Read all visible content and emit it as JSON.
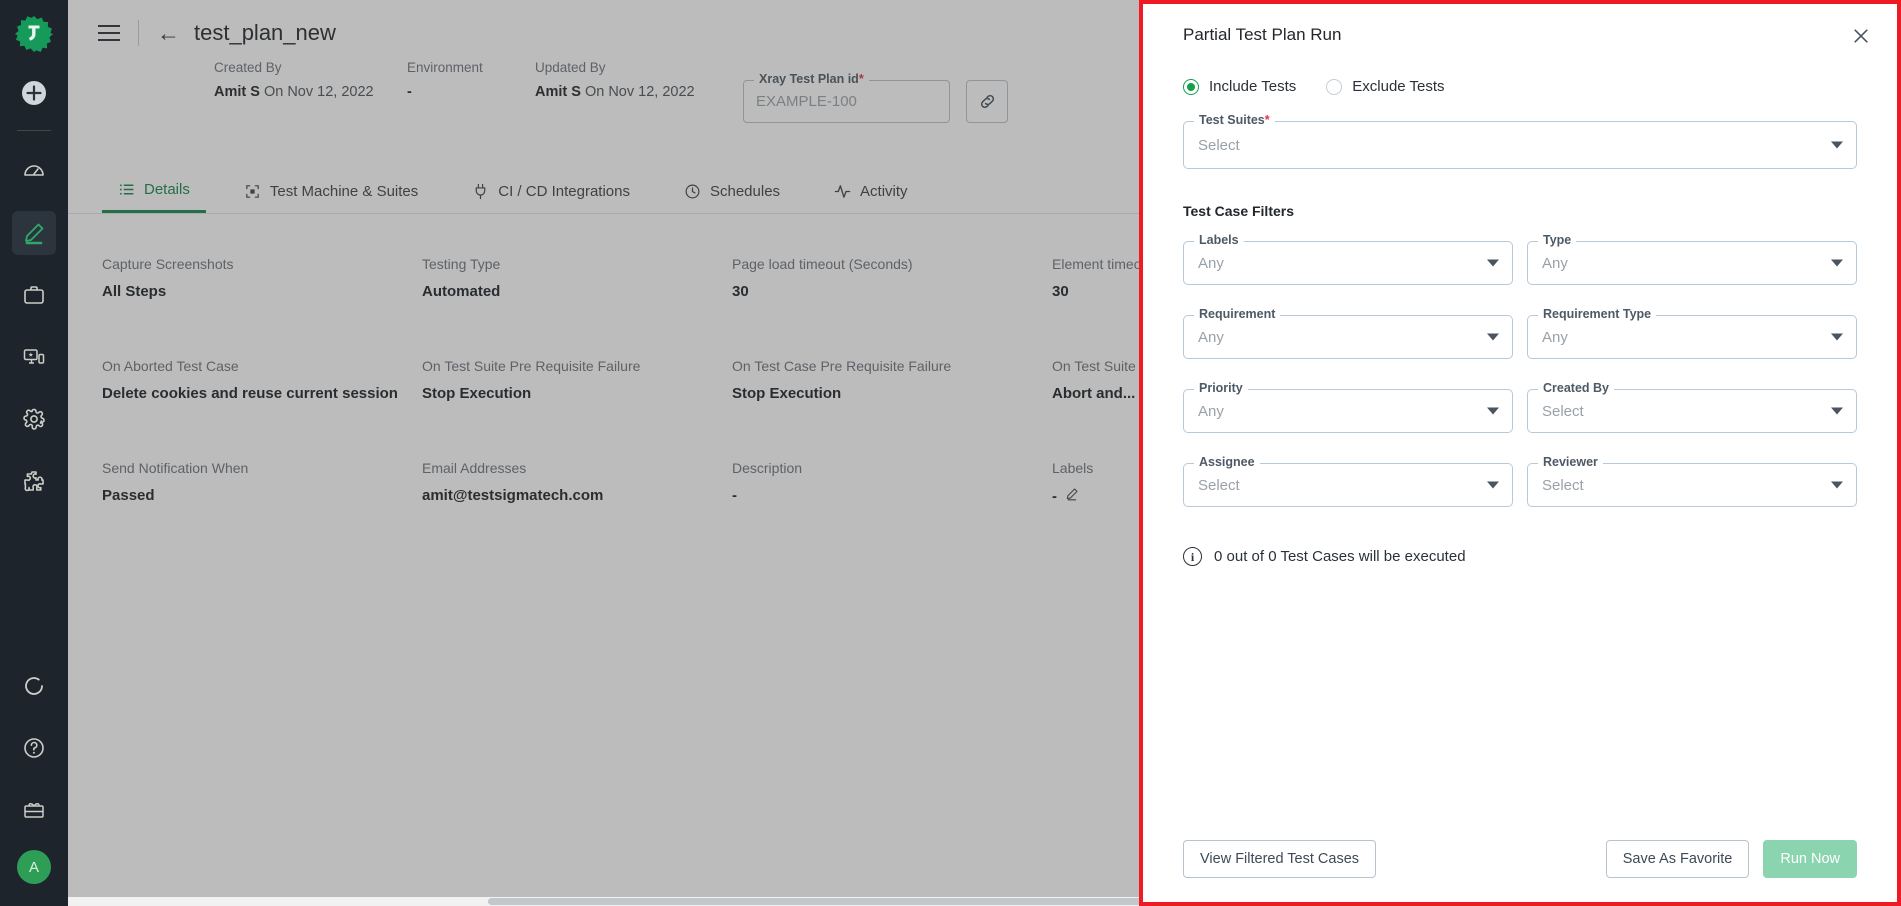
{
  "rail": {
    "logo_icon": "testsigma-logo-icon",
    "add_icon": "plus-circle-icon",
    "items": [
      {
        "icon": "speedometer-icon",
        "name": "dashboard",
        "active": false
      },
      {
        "icon": "pencil-icon",
        "name": "create-tests",
        "active": true
      },
      {
        "icon": "briefcase-icon",
        "name": "projects",
        "active": false
      },
      {
        "icon": "test-lab-icon",
        "name": "test-lab",
        "active": false
      },
      {
        "icon": "gear-icon",
        "name": "settings",
        "active": false
      },
      {
        "icon": "puzzle-icon",
        "name": "addons",
        "active": false
      }
    ],
    "bottom_items": [
      {
        "icon": "progress-circle-icon",
        "name": "running-jobs"
      },
      {
        "icon": "help-circle-icon",
        "name": "help"
      },
      {
        "icon": "gift-icon",
        "name": "whats-new"
      }
    ],
    "avatar_initial": "A"
  },
  "topbar": {
    "menu_icon": "hamburger-icon",
    "back_icon": "back-arrow-icon",
    "plan_title": "test_plan_new",
    "meta": [
      {
        "label": "Created By",
        "value_bold": "Amit S",
        "value_rest": "On Nov 12, 2022"
      },
      {
        "label": "Environment",
        "value_bold": "-",
        "value_rest": ""
      },
      {
        "label": "Updated By",
        "value_bold": "Amit S",
        "value_rest": "On Nov 12, 2022"
      }
    ],
    "xray": {
      "legend": "Xray Test Plan id",
      "required_mark": "*",
      "placeholder": "EXAMPLE-100",
      "link_icon": "link-icon"
    }
  },
  "tabs": [
    {
      "label": "Details",
      "icon": "list-icon",
      "active": true
    },
    {
      "label": "Test Machine & Suites",
      "icon": "machine-icon",
      "active": false
    },
    {
      "label": "CI / CD Integrations",
      "icon": "plug-icon",
      "active": false
    },
    {
      "label": "Schedules",
      "icon": "clock-icon",
      "active": false
    },
    {
      "label": "Activity",
      "icon": "activity-icon",
      "active": false
    }
  ],
  "details_rows": [
    [
      {
        "label": "Capture Screenshots",
        "value": "All Steps"
      },
      {
        "label": "Testing Type",
        "value": "Automated"
      },
      {
        "label": "Page load timeout (Seconds)",
        "value": "30"
      },
      {
        "label": "Element timeout (Seconds)",
        "value": "30"
      }
    ],
    [
      {
        "label": "On Aborted Test Case",
        "value": "Delete cookies and reuse current session"
      },
      {
        "label": "On Test Suite Pre Requisite Failure",
        "value": "Stop Execution"
      },
      {
        "label": "On Test Case Pre Requisite Failure",
        "value": "Stop Execution"
      },
      {
        "label": "On Test Suite Pre Requisite Failure",
        "value": "Abort and..."
      }
    ],
    [
      {
        "label": "Send Notification When",
        "value": "Passed"
      },
      {
        "label": "Email Addresses",
        "value": "amit@testsigmatech.com"
      },
      {
        "label": "Description",
        "value": "-"
      },
      {
        "label": "Labels",
        "value": "-"
      }
    ]
  ],
  "modal": {
    "title": "Partial Test Plan Run",
    "close_icon": "close-icon",
    "highlight_color": "#ee1b25",
    "radios": [
      {
        "label": "Include Tests",
        "selected": true
      },
      {
        "label": "Exclude Tests",
        "selected": false
      }
    ],
    "test_suites": {
      "legend": "Test Suites",
      "required_mark": "*",
      "placeholder": "Select"
    },
    "filters_title": "Test Case Filters",
    "filters": [
      {
        "legend": "Labels",
        "placeholder": "Any"
      },
      {
        "legend": "Type",
        "placeholder": "Any"
      },
      {
        "legend": "Requirement",
        "placeholder": "Any"
      },
      {
        "legend": "Requirement Type",
        "placeholder": "Any"
      },
      {
        "legend": "Priority",
        "placeholder": "Any"
      },
      {
        "legend": "Created By",
        "placeholder": "Select"
      },
      {
        "legend": "Assignee",
        "placeholder": "Select"
      },
      {
        "legend": "Reviewer",
        "placeholder": "Select"
      }
    ],
    "exec_note": "0 out of 0 Test Cases will be executed",
    "exec_note_icon": "info-icon",
    "buttons": {
      "view_filtered": "View Filtered Test Cases",
      "save_favorite": "Save As Favorite",
      "run_now": "Run Now",
      "run_now_color": "#8bd4b0"
    }
  }
}
